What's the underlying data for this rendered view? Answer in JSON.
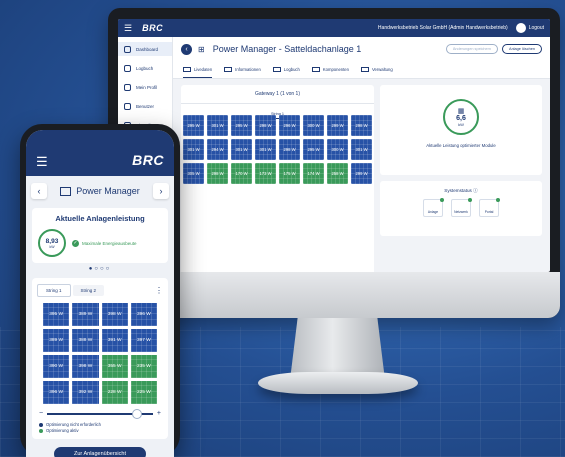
{
  "colors": {
    "brand_navy": "#1f3a73",
    "panel_blue": "#2752a6",
    "optimized_green": "#3a9a5a",
    "background": "#2a5da8"
  },
  "desktop": {
    "logo": "BRC",
    "user": "Handwerksbetrieb Solar GmbH (Admin Handwerksbetrieb)",
    "logout": "Logout",
    "sidebar": [
      {
        "label": "Dashboard",
        "icon": "home-icon"
      },
      {
        "label": "Logbuch",
        "icon": "book-icon"
      },
      {
        "label": "Mein Profil",
        "icon": "user-icon"
      },
      {
        "label": "Benutzer",
        "icon": "users-icon"
      },
      {
        "label": "Einstellungen",
        "icon": "gear-icon"
      }
    ],
    "title": "Power Manager - Satteldachanlage 1",
    "btn_disabled": "Änderungen speichern",
    "btn_delete": "Anlage löschen",
    "tabs": [
      "Livedaten",
      "Informationen",
      "Logbuch",
      "Komponenten",
      "Verwaltung"
    ],
    "gateway_title": "Gateway 1 (1 von 1)",
    "string_label": "String 1",
    "tiles": [
      {
        "v": "295 W",
        "g": false
      },
      {
        "v": "301 W",
        "g": false
      },
      {
        "v": "295 W",
        "g": false
      },
      {
        "v": "298 W",
        "g": false
      },
      {
        "v": "296 W",
        "g": false
      },
      {
        "v": "300 W",
        "g": false
      },
      {
        "v": "299 W",
        "g": false
      },
      {
        "v": "298 W",
        "g": false
      },
      {
        "v": "301 W",
        "g": false
      },
      {
        "v": "294 W",
        "g": false
      },
      {
        "v": "301 W",
        "g": false
      },
      {
        "v": "301 W",
        "g": false
      },
      {
        "v": "298 W",
        "g": false
      },
      {
        "v": "295 W",
        "g": false
      },
      {
        "v": "300 W",
        "g": false
      },
      {
        "v": "301 W",
        "g": false
      },
      {
        "v": "305 W",
        "g": false
      },
      {
        "v": "298 W",
        "g": true
      },
      {
        "v": "170 W",
        "g": true
      },
      {
        "v": "173 W",
        "g": true
      },
      {
        "v": "175 W",
        "g": true
      },
      {
        "v": "174 W",
        "g": true
      },
      {
        "v": "258 W",
        "g": true
      },
      {
        "v": "299 W",
        "g": false
      }
    ],
    "power_value": "6,6",
    "power_unit": "kW",
    "power_label": "Aktuelle Leistung optimierter Module",
    "system_status_title": "Systemstatus",
    "system_items": [
      "Anlage",
      "Netzwerk",
      "Portal"
    ]
  },
  "mobile": {
    "logo": "BRC",
    "title": "Power Manager",
    "card_title": "Aktuelle Anlagenleistung",
    "power_value": "8,93",
    "power_unit": "kW",
    "max_label": "Maximale Energieausbeute",
    "dots": "●○○○",
    "tabs": [
      "String 1",
      "String 2"
    ],
    "tiles": [
      {
        "v": "395 W",
        "g": false
      },
      {
        "v": "389 W",
        "g": false
      },
      {
        "v": "398 W",
        "g": false
      },
      {
        "v": "396 W",
        "g": false
      },
      {
        "v": "389 W",
        "g": false
      },
      {
        "v": "388 W",
        "g": false
      },
      {
        "v": "391 W",
        "g": false
      },
      {
        "v": "397 W",
        "g": false
      },
      {
        "v": "390 W",
        "g": false
      },
      {
        "v": "398 W",
        "g": false
      },
      {
        "v": "355 W",
        "g": true
      },
      {
        "v": "235 W",
        "g": true
      },
      {
        "v": "396 W",
        "g": false
      },
      {
        "v": "392 W",
        "g": false
      },
      {
        "v": "228 W",
        "g": true
      },
      {
        "v": "225 W",
        "g": true
      }
    ],
    "slider_level": 0.85,
    "legend": [
      "Optimierung nicht erforderlich",
      "Optimierung aktiv"
    ],
    "cta": "Zur Anlagenübersicht"
  }
}
